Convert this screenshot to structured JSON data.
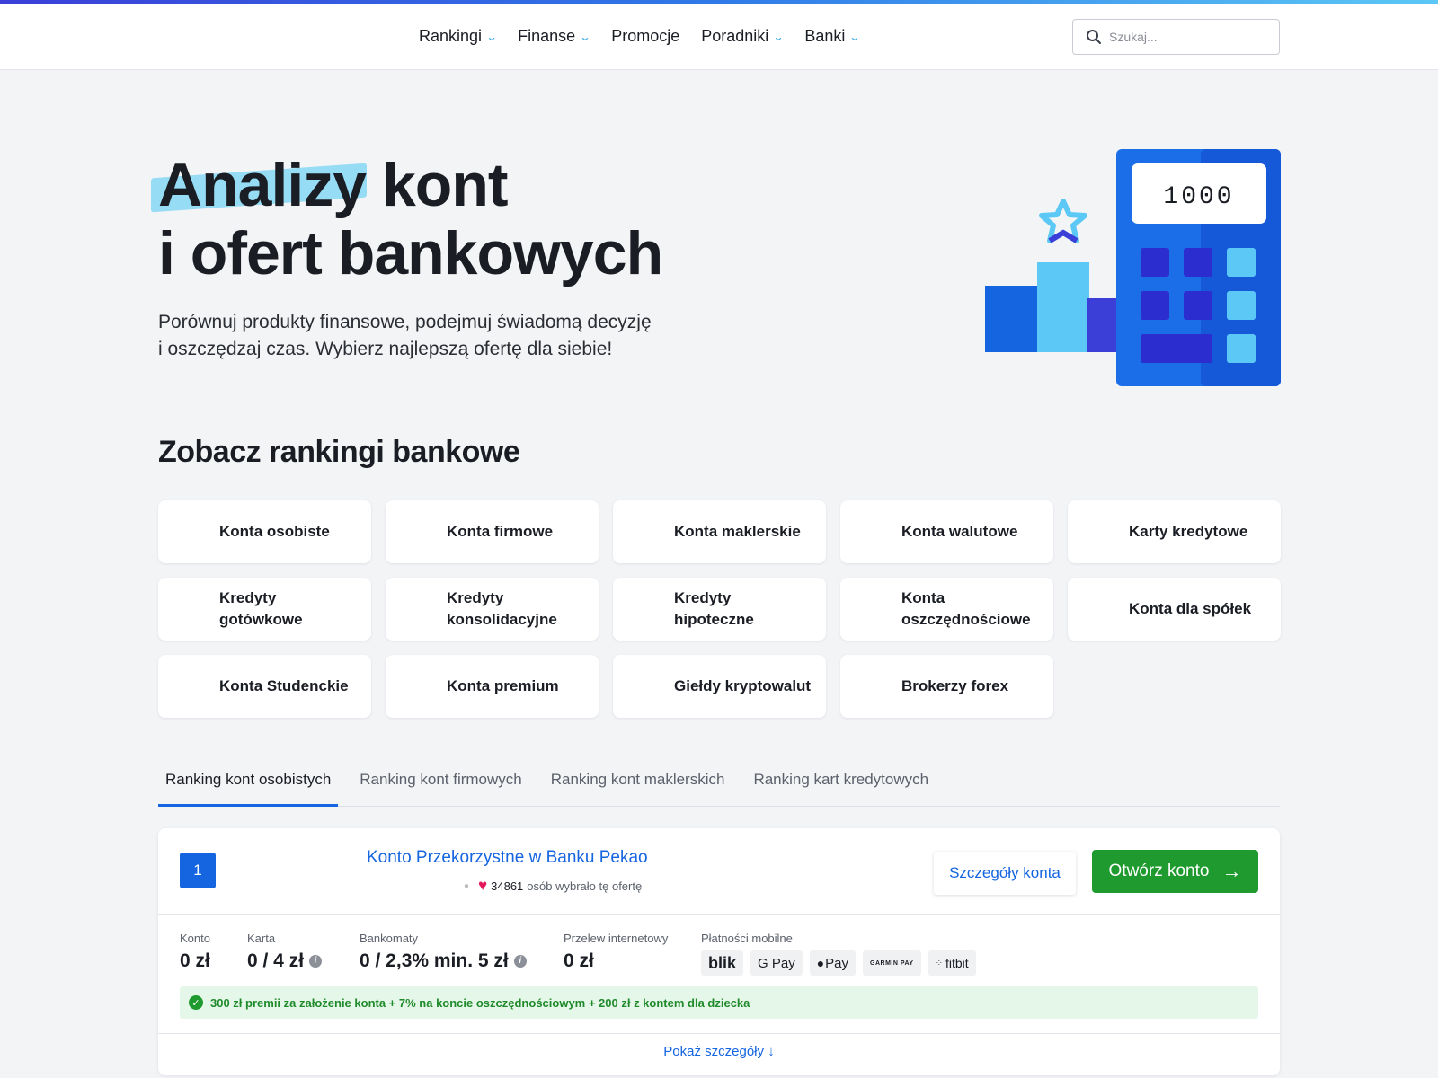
{
  "header": {
    "nav": [
      {
        "label": "Rankingi",
        "dropdown": true
      },
      {
        "label": "Finanse",
        "dropdown": true
      },
      {
        "label": "Promocje",
        "dropdown": false
      },
      {
        "label": "Poradniki",
        "dropdown": true
      },
      {
        "label": "Banki",
        "dropdown": true
      }
    ],
    "search_placeholder": "Szukaj..."
  },
  "hero": {
    "title_highlight": "Analizy",
    "title_rest_line1": " kont",
    "title_line2": "i ofert bankowych",
    "subtitle_line1": "Porównuj produkty finansowe, podejmuj świadomą decyzję",
    "subtitle_line2": "i oszczędzaj czas. Wybierz najlepszą ofertę dla siebie!",
    "calculator_display": "1000"
  },
  "rankings": {
    "heading": "Zobacz rankingi bankowe",
    "tiles": [
      "Konta osobiste",
      "Konta firmowe",
      "Konta maklerskie",
      "Konta walutowe",
      "Karty kredytowe",
      "Kredyty gotówkowe",
      "Kredyty konsolidacyjne",
      "Kredyty hipoteczne",
      "Konta oszczędnościowe",
      "Konta dla spółek",
      "Konta Studenckie",
      "Konta premium",
      "Giełdy kryptowalut",
      "Brokerzy forex"
    ]
  },
  "tabs": [
    {
      "label": "Ranking kont osobistych",
      "active": true
    },
    {
      "label": "Ranking kont firmowych",
      "active": false
    },
    {
      "label": "Ranking kont maklerskich",
      "active": false
    },
    {
      "label": "Ranking kart kredytowych",
      "active": false
    }
  ],
  "offer": {
    "rank": "1",
    "name": "Konto Przekorzystne w Banku Pekao",
    "likes_count": "34861",
    "likes_text": "osób wybrało tę ofertę",
    "details_button": "Szczegóły konta",
    "open_button": "Otwórz konto",
    "stats": {
      "konto_label": "Konto",
      "konto_value": "0 zł",
      "karta_label": "Karta",
      "karta_value": "0 / 4 zł",
      "bankomaty_label": "Bankomaty",
      "bankomaty_value": "0 / 2,3% min. 5 zł",
      "przelew_label": "Przelew internetowy",
      "przelew_value": "0 zł",
      "platnosci_label": "Płatności mobilne"
    },
    "payments": [
      "blik",
      "G Pay",
      "Pay",
      "GARMIN PAY",
      "fitbit"
    ],
    "promo": "300 zł premii za założenie konta + 7% na koncie oszczędnościowym + 200 zł z kontem dla dziecka",
    "show_more": "Pokaż szczegóły"
  },
  "colors": {
    "accent_blue": "#1565e0",
    "cta_green": "#1f9a2e",
    "highlight_cyan": "#7fd6f5",
    "promo_bg": "#e5f7e8"
  }
}
